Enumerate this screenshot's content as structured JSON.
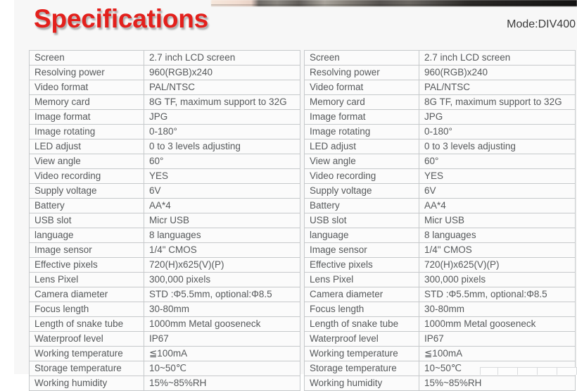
{
  "header": {
    "title": "Specifications",
    "mode_label": "Mode:DIV400",
    "title_color": "#e3201c",
    "mode_color": "#3b3b3b"
  },
  "spec_table": {
    "rows": [
      {
        "key": "Screen",
        "value": "2.7 inch LCD screen"
      },
      {
        "key": "Resolving power",
        "value": "960(RGB)x240"
      },
      {
        "key": "Video format",
        "value": "PAL/NTSC"
      },
      {
        "key": "Memory card",
        "value": "8G TF, maximum support to 32G"
      },
      {
        "key": "Image format",
        "value": "JPG"
      },
      {
        "key": "Image rotating",
        "value": "0-180°"
      },
      {
        "key": "LED adjust",
        "value": "0 to 3 levels adjusting"
      },
      {
        "key": "View angle",
        "value": "60°"
      },
      {
        "key": "Video recording",
        "value": "YES"
      },
      {
        "key": "Supply voltage",
        "value": "6V"
      },
      {
        "key": "Battery",
        "value": "AA*4"
      },
      {
        "key": "USB slot",
        "value": "Micr USB"
      },
      {
        "key": "language",
        "value": "8 languages"
      },
      {
        "key": "Image sensor",
        "value": "1/4\" CMOS"
      },
      {
        "key": "Effective pixels",
        "value": "720(H)x625(V)(P)"
      },
      {
        "key": "Lens Pixel",
        "value": "300,000 pixels"
      },
      {
        "key": "Camera diameter",
        "value": "STD :Φ5.5mm, optional:Φ8.5"
      },
      {
        "key": "Focus length",
        "value": "30-80mm"
      },
      {
        "key": "Length of snake tube",
        "value": "1000mm Metal gooseneck"
      },
      {
        "key": "Waterproof level",
        "value": "IP67"
      },
      {
        "key": "Working temperature",
        "value": "≦100mA"
      },
      {
        "key": "Storage temperature",
        "value": "10~50℃"
      },
      {
        "key": "Working humidity",
        "value": "15%~85%RH"
      }
    ]
  },
  "panels": [
    {
      "name": "left-spec-table"
    },
    {
      "name": "right-spec-table"
    }
  ]
}
